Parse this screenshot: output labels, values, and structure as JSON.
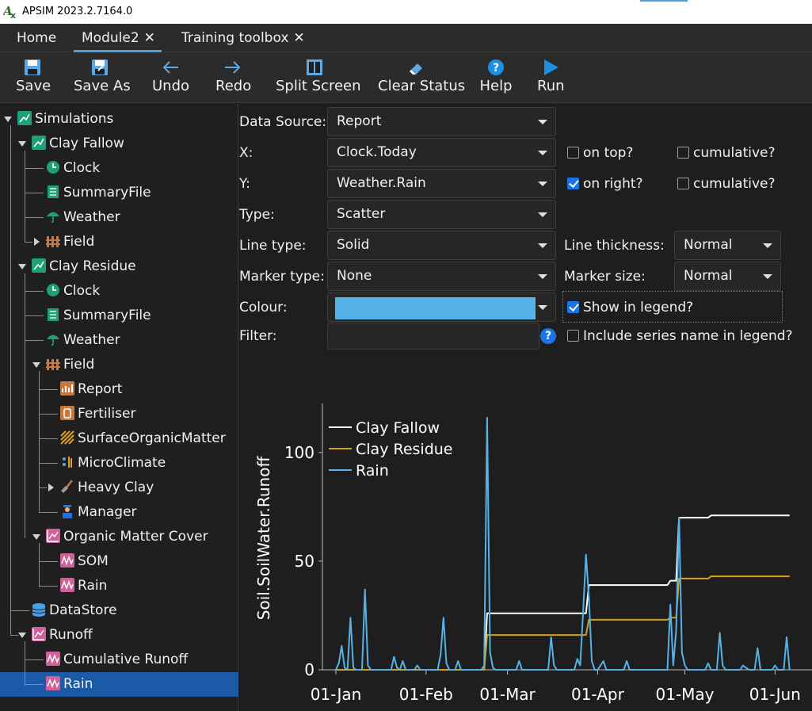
{
  "app": {
    "title": "APSIM 2023.2.7164.0"
  },
  "tabs": [
    {
      "label": "Home",
      "closable": false
    },
    {
      "label": "Module2",
      "closable": true,
      "active": true
    },
    {
      "label": "Training toolbox",
      "closable": true
    }
  ],
  "toolbar": {
    "save": "Save",
    "save_as": "Save As",
    "undo": "Undo",
    "redo": "Redo",
    "split_screen": "Split Screen",
    "clear_status": "Clear Status",
    "help": "Help",
    "run": "Run"
  },
  "tree": {
    "simulations": "Simulations",
    "clay_fallow": {
      "label": "Clay Fallow",
      "clock": "Clock",
      "summary": "SummaryFile",
      "weather": "Weather",
      "field": "Field"
    },
    "clay_residue": {
      "label": "Clay Residue",
      "clock": "Clock",
      "summary": "SummaryFile",
      "weather": "Weather",
      "field": {
        "label": "Field",
        "report": "Report",
        "fertiliser": "Fertiliser",
        "som": "SurfaceOrganicMatter",
        "microclimate": "MicroClimate",
        "soil": "Heavy Clay",
        "manager": "Manager"
      },
      "omc": {
        "label": "Organic Matter Cover",
        "som": "SOM",
        "rain": "Rain"
      }
    },
    "datastore": "DataStore",
    "runoff": {
      "label": "Runoff",
      "cumulative": "Cumulative Runoff",
      "rain": "Rain"
    }
  },
  "props": {
    "data_source_label": "Data Source:",
    "data_source": "Report",
    "x_label": "X:",
    "x_value": "Clock.Today",
    "y_label": "Y:",
    "y_value": "Weather.Rain",
    "type_label": "Type:",
    "type_value": "Scatter",
    "line_type_label": "Line type:",
    "line_type": "Solid",
    "marker_type_label": "Marker type:",
    "marker_type": "None",
    "colour_label": "Colour:",
    "colour": "#55b2e8",
    "filter_label": "Filter:",
    "filter_value": "",
    "line_thickness_label": "Line thickness:",
    "line_thickness": "Normal",
    "marker_size_label": "Marker size:",
    "marker_size": "Normal",
    "on_top": {
      "label": "on top?",
      "checked": false
    },
    "x_cumulative": {
      "label": "cumulative?",
      "checked": false
    },
    "on_right": {
      "label": "on right?",
      "checked": true
    },
    "y_cumulative": {
      "label": "cumulative?",
      "checked": false
    },
    "show_in_legend": {
      "label": "Show in legend?",
      "checked": true
    },
    "include_series_name": {
      "label": "Include series name in legend?",
      "checked": false
    }
  },
  "chart_data": {
    "type": "line",
    "ylabel": "Soil.SoilWater.Runoff",
    "xlabel": "",
    "ylim": [
      0,
      120
    ],
    "yticks": [
      0,
      50,
      100
    ],
    "xlim": [
      0,
      155
    ],
    "xticks": [
      {
        "day": 0,
        "label": "01-Jan"
      },
      {
        "day": 31,
        "label": "01-Feb"
      },
      {
        "day": 59,
        "label": "01-Mar"
      },
      {
        "day": 90,
        "label": "01-Apr"
      },
      {
        "day": 120,
        "label": "01-May"
      },
      {
        "day": 151,
        "label": "01-Jun"
      }
    ],
    "legend_position": "top-left",
    "series": [
      {
        "name": "Clay Fallow",
        "color": "#ffffff",
        "points": [
          [
            0,
            0
          ],
          [
            51,
            0
          ],
          [
            52,
            26
          ],
          [
            86,
            26
          ],
          [
            87,
            39
          ],
          [
            114,
            39
          ],
          [
            115,
            41
          ],
          [
            117,
            41
          ],
          [
            118,
            70
          ],
          [
            128,
            70
          ],
          [
            129,
            71
          ],
          [
            156,
            71
          ]
        ]
      },
      {
        "name": "Clay Residue",
        "color": "#d4a017",
        "points": [
          [
            0,
            0
          ],
          [
            51,
            0
          ],
          [
            52,
            16
          ],
          [
            86,
            16
          ],
          [
            87,
            23
          ],
          [
            114,
            23
          ],
          [
            115,
            24
          ],
          [
            117,
            24
          ],
          [
            118,
            42
          ],
          [
            128,
            42
          ],
          [
            129,
            43
          ],
          [
            156,
            43
          ]
        ]
      },
      {
        "name": "Rain",
        "color": "#55b2e8",
        "points": [
          [
            0,
            0
          ],
          [
            1,
            3
          ],
          [
            2,
            11
          ],
          [
            3,
            1
          ],
          [
            4,
            0
          ],
          [
            5,
            24
          ],
          [
            6,
            1
          ],
          [
            7,
            0
          ],
          [
            9,
            0
          ],
          [
            10,
            37
          ],
          [
            11,
            2
          ],
          [
            12,
            0
          ],
          [
            19,
            0
          ],
          [
            20,
            6
          ],
          [
            21,
            1
          ],
          [
            22,
            0
          ],
          [
            23,
            4
          ],
          [
            24,
            0
          ],
          [
            27,
            0
          ],
          [
            28,
            2
          ],
          [
            29,
            0
          ],
          [
            35,
            0
          ],
          [
            36,
            7
          ],
          [
            37,
            24
          ],
          [
            38,
            3
          ],
          [
            39,
            0
          ],
          [
            41,
            0
          ],
          [
            42,
            4
          ],
          [
            43,
            0
          ],
          [
            50,
            0
          ],
          [
            51,
            2
          ],
          [
            52,
            116
          ],
          [
            53,
            8
          ],
          [
            54,
            1
          ],
          [
            55,
            0
          ],
          [
            62,
            0
          ],
          [
            63,
            4
          ],
          [
            64,
            0
          ],
          [
            73,
            0
          ],
          [
            74,
            15
          ],
          [
            75,
            2
          ],
          [
            76,
            0
          ],
          [
            82,
            0
          ],
          [
            83,
            5
          ],
          [
            84,
            2
          ],
          [
            85,
            26
          ],
          [
            86,
            53
          ],
          [
            87,
            33
          ],
          [
            88,
            4
          ],
          [
            89,
            0
          ],
          [
            90,
            0
          ],
          [
            91,
            2
          ],
          [
            92,
            4
          ],
          [
            93,
            0
          ],
          [
            99,
            0
          ],
          [
            100,
            4
          ],
          [
            101,
            0
          ],
          [
            114,
            0
          ],
          [
            115,
            30
          ],
          [
            116,
            2
          ],
          [
            117,
            18
          ],
          [
            118,
            70
          ],
          [
            119,
            8
          ],
          [
            120,
            2
          ],
          [
            121,
            0
          ],
          [
            127,
            0
          ],
          [
            128,
            3
          ],
          [
            129,
            0
          ],
          [
            131,
            0
          ],
          [
            132,
            17
          ],
          [
            133,
            2
          ],
          [
            134,
            0
          ],
          [
            139,
            0
          ],
          [
            140,
            2
          ],
          [
            141,
            1
          ],
          [
            142,
            0
          ],
          [
            144,
            0
          ],
          [
            145,
            10
          ],
          [
            146,
            0
          ],
          [
            150,
            0
          ],
          [
            151,
            2
          ],
          [
            152,
            0
          ],
          [
            154,
            0
          ],
          [
            155,
            15
          ],
          [
            156,
            0
          ]
        ]
      }
    ]
  }
}
